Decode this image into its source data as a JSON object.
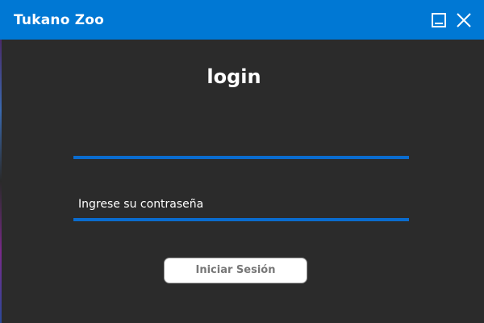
{
  "window": {
    "title": "Tukano Zoo"
  },
  "colors": {
    "titlebar": "#0078d4",
    "background": "#2b2b2b",
    "field_underline": "#0a6ccf",
    "button_background": "#ffffff",
    "button_text": "#777777"
  },
  "titlebar_buttons": [
    {
      "name": "minimize",
      "icon": "minimize-icon"
    },
    {
      "name": "close",
      "icon": "close-icon"
    }
  ],
  "login": {
    "heading": "login",
    "username": {
      "value": "",
      "placeholder": ""
    },
    "password": {
      "value": "",
      "placeholder": "Ingrese su contraseña"
    },
    "submit_label": "Iniciar Sesión"
  }
}
